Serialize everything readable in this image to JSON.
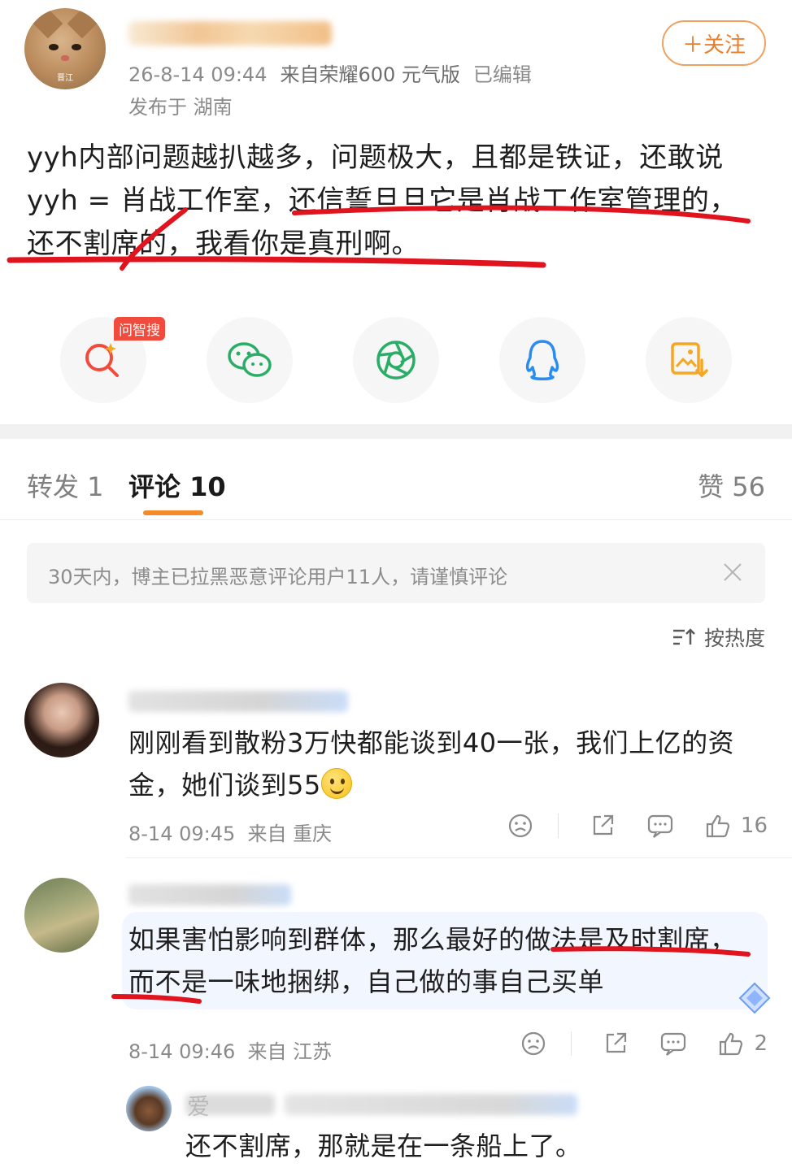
{
  "post": {
    "time": "26-8-14 09:44",
    "device": "来自荣耀600 元气版",
    "edited": "已编辑",
    "location": "发布于 湖南",
    "follow_label": "＋关注",
    "avatar_tag": "晋江",
    "text": "yyh内部问题越扒越多，问题极大，且都是铁证，还敢说yyh = 肖战工作室，还信誓旦旦它是肖战工作室管理的，还不割席的，我看你是真刑啊。"
  },
  "share": {
    "badge": "问智搜",
    "buttons": [
      {
        "icon": "ai-search-icon",
        "color": "#f04b3d"
      },
      {
        "icon": "wechat-icon",
        "color": "#2aae67"
      },
      {
        "icon": "moments-icon",
        "color": "#2aae67"
      },
      {
        "icon": "qq-icon",
        "color": "#2a8cf0"
      },
      {
        "icon": "save-image-icon",
        "color": "#f5a623"
      }
    ]
  },
  "tabs": {
    "repost": "转发 1",
    "comment": "评论 10",
    "like": "赞 56"
  },
  "notice": {
    "text": "30天内，博主已拉黑恶意评论用户11人，请谨慎评论"
  },
  "sort": {
    "label": "按热度"
  },
  "comments": [
    {
      "text": "刚刚看到散粉3万快都能谈到40一张，我们上亿的资金，她们谈到55",
      "time": "8-14 09:45",
      "from": "来自 重庆",
      "likes": "16"
    },
    {
      "text": "如果害怕影响到群体，那么最好的做法是及时割席，而不是一味地捆绑，自己做的事自己买单",
      "time": "8-14 09:46",
      "from": "来自 江苏",
      "likes": "2",
      "reply": {
        "name": "爱",
        "text": "还不割席，那就是在一条船上了。"
      }
    }
  ],
  "colors": {
    "accent": "#f58a2c",
    "follow": "#ef7c28",
    "annotation": "#e0141e"
  }
}
